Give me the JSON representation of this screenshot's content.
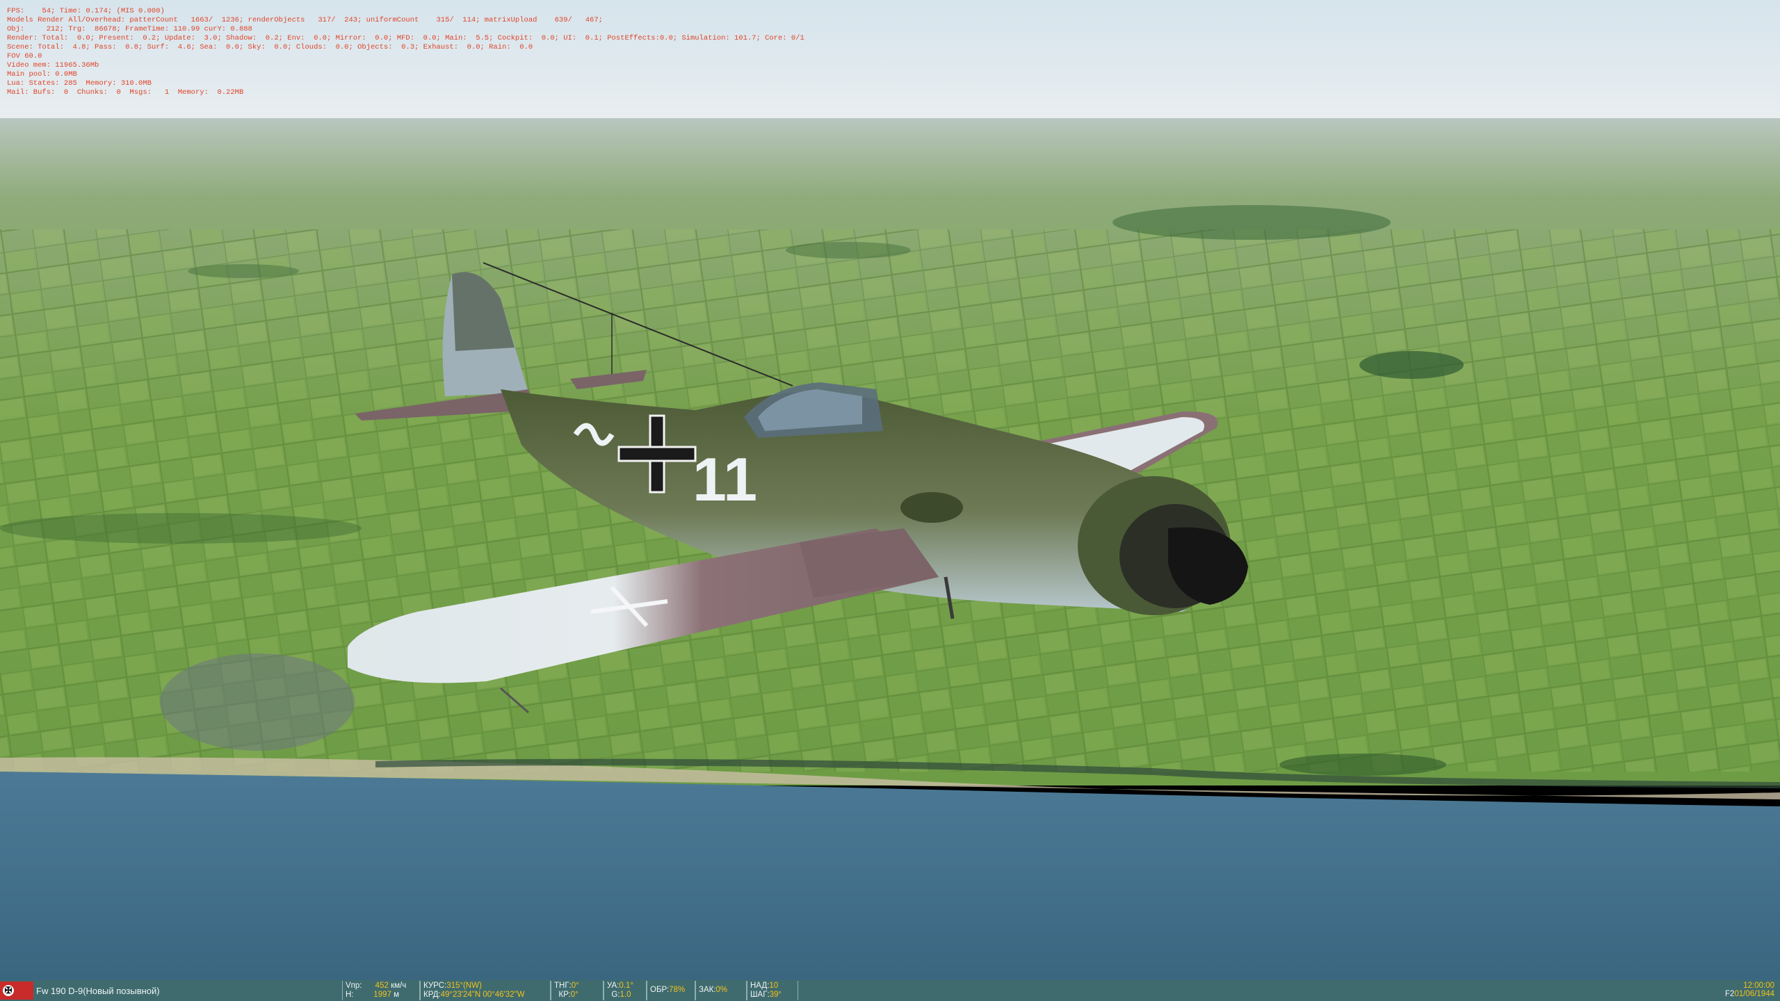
{
  "debug_lines": [
    "FPS:    54; Time: 0.174; (MIS 0.000)",
    "Models Render All/Overhead: patterCount   1663/  1236; renderObjects   317/  243; uniformCount    315/  114; matrixUpload    639/   467;",
    "Obj:     212; Trg:  86678; FrameTime: 110.99 curY: 0.888",
    "Render: Total:  0.0; Present:  0.2; Update:  3.0; Shadow:  0.2; Env:  0.0; Mirror:  0.0; MFD:  0.0; Main:  5.5; Cockpit:  0.0; UI:  0.1; PostEffects:0.0; Simulation: 101.7; Core: 0/1",
    "Scene: Total:  4.8; Pass:  0.8; Surf:  4.6; Sea:  0.0; Sky:  0.0; Clouds:  0.0; Objects:  0.3; Exhaust:  0.0; Rain:  0.0",
    "FOV 60.0",
    "Video mem: 11965.36Mb",
    "Main pool: 0.0MB",
    "Lua: States: 285  Memory: 310.0MB",
    "Mail: Bufs:  0  Chunks:  0  Msgs:   1  Memory:  0.22MB"
  ],
  "aircraft": {
    "tail_number": "11",
    "name": "Fw 190 D-9(Новый позывной)"
  },
  "hud": {
    "vpr_label": "Vпр:",
    "vpr_value": "452",
    "vpr_unit": "км/ч",
    "h_label": "H:",
    "h_value": "1997",
    "h_unit": "м",
    "kurs_label": "КУРС:",
    "kurs_value": "315°(NW)",
    "krd_label": "КРД:",
    "krd_value": "49°23'24\"N 00°46'32\"W",
    "tng_label": "ТНГ:",
    "tng_value": "0°",
    "kr_label": "КР:",
    "kr_value": "0°",
    "ua_label": "УА:",
    "ua_value": "0.1°",
    "g_label": "G:",
    "g_value": "1.0",
    "obr_label": "ОБР:",
    "obr_value": "78%",
    "zak_label": "ЗАК:",
    "zak_value": "0%",
    "nad_label": "НАД:",
    "nad_value": "10",
    "shag_label": "ШАГ:",
    "shag_value": "39°",
    "time": "12:00:00",
    "camera": "F2",
    "date": "01/06/1944"
  },
  "colors": {
    "debug_text": "#e0442a",
    "hud_bg": "#3f6b6f",
    "hud_value": "#f2c21a",
    "sea": "#3d6a85",
    "land": "#6f9a48"
  }
}
